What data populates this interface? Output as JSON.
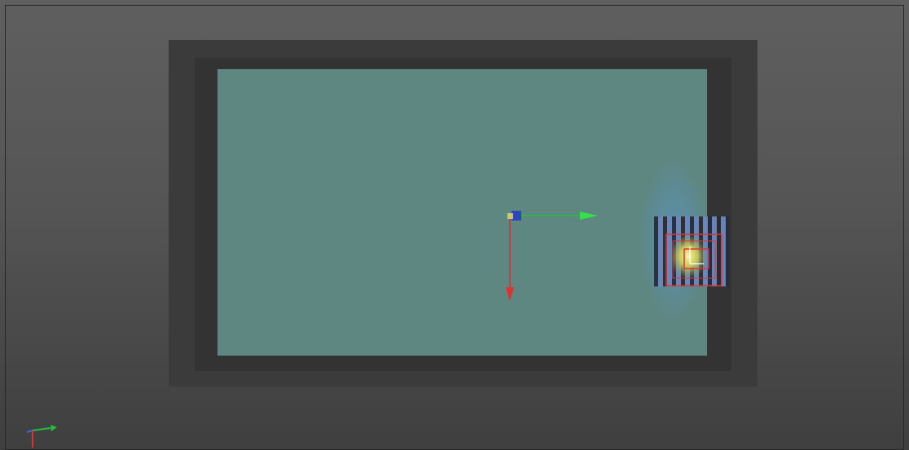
{
  "viewport": {
    "background_top": "#5f5f5f",
    "background_bottom": "#3f3f3f"
  },
  "scene": {
    "plane_color": "#5e8782",
    "frame_color": "#3b3b3b",
    "inner_frame_color": "#333333"
  },
  "manipulator": {
    "icon": "move-manipulator-icon",
    "x_axis_color": "#22c23a",
    "y_axis_color": "#e03030",
    "center_color": "#2a3fbf"
  },
  "light": {
    "icon": "spot-light-icon",
    "selection_color": "#e0353a",
    "core_color": "#f4e66a",
    "halo_color": "#5a98d8"
  },
  "axis_indicator": {
    "icon": "view-axis-icon",
    "x_color": "#22c23a",
    "y_color": "#e03030",
    "z_color": "#3a6ad8"
  }
}
